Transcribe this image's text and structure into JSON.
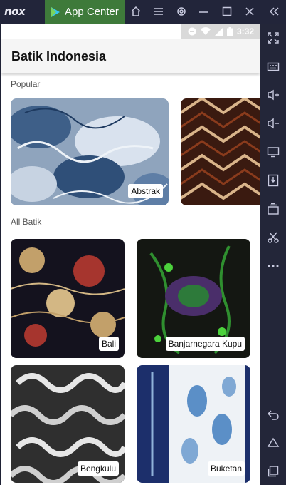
{
  "emulator": {
    "logo": "nox",
    "active_tab": "App Center",
    "titlebar_icons": [
      "home-icon",
      "menu-icon",
      "settings-icon",
      "minimize-icon",
      "maximize-icon",
      "close-icon",
      "collapse-icon"
    ],
    "sidebar_icons": [
      "fullscreen-icon",
      "keyboard-icon",
      "volume-up-icon",
      "volume-down-icon",
      "screen-icon",
      "apk-install-icon",
      "multi-instance-icon",
      "scissors-icon",
      "more-icon",
      "back-icon",
      "home-nav-icon",
      "recent-apps-icon"
    ]
  },
  "status_bar": {
    "time": "3:32"
  },
  "app": {
    "title": "Batik Indonesia"
  },
  "sections": {
    "popular": "Popular",
    "all": "All Batik"
  },
  "popular_items": [
    {
      "label": "Abstrak"
    },
    {
      "label": ""
    }
  ],
  "all_items": [
    {
      "label": "Bali"
    },
    {
      "label": "Banjarnegara Kupu"
    },
    {
      "label": "Bengkulu"
    },
    {
      "label": "Buketan"
    }
  ],
  "colors": {
    "appcenter_bg": "#3e7a3a",
    "emulator_bg": "#232639"
  }
}
